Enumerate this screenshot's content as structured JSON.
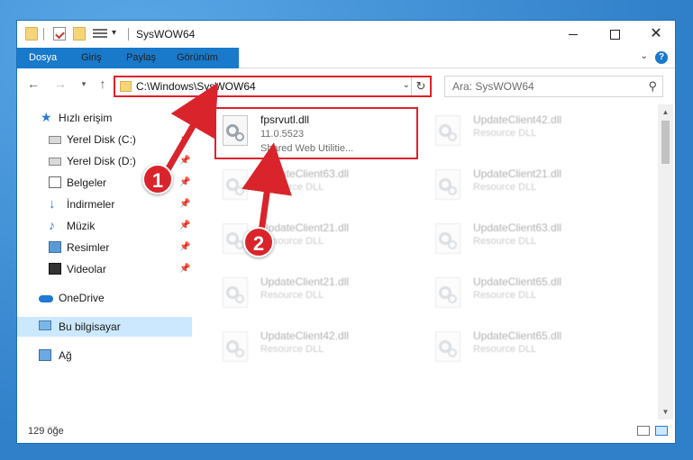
{
  "window": {
    "title": "SysWOW64"
  },
  "ribbon": {
    "tabs": [
      "Dosya",
      "Giriş",
      "Paylaş",
      "Görünüm"
    ],
    "help": "?"
  },
  "address": {
    "path": "C:\\Windows\\SysWOW64",
    "search_placeholder": "Ara: SysWOW64"
  },
  "sidebar": {
    "items": [
      {
        "label": "Hızlı erişim",
        "icon": "star-icon",
        "pinned": false
      },
      {
        "label": "Yerel Disk (C:)",
        "icon": "disk-icon",
        "pinned": true
      },
      {
        "label": "Yerel Disk (D:)",
        "icon": "disk-icon",
        "pinned": true
      },
      {
        "label": "Belgeler",
        "icon": "document-icon",
        "pinned": true
      },
      {
        "label": "İndirmeler",
        "icon": "download-icon",
        "pinned": true
      },
      {
        "label": "Müzik",
        "icon": "music-icon",
        "pinned": true
      },
      {
        "label": "Resimler",
        "icon": "pictures-icon",
        "pinned": true
      },
      {
        "label": "Videolar",
        "icon": "video-icon",
        "pinned": true
      },
      {
        "label": "OneDrive",
        "icon": "cloud-icon",
        "pinned": false
      },
      {
        "label": "Bu bilgisayar",
        "icon": "computer-icon",
        "pinned": false
      },
      {
        "label": "Ağ",
        "icon": "network-icon",
        "pinned": false
      }
    ]
  },
  "files": {
    "highlighted": {
      "name": "fpsrvutl.dll",
      "version": "11.0.5523",
      "description": "Shared Web Utilitie..."
    },
    "faded": [
      {
        "name": "UpdateClient42.dll",
        "description": "Resource DLL"
      },
      {
        "name": "UpdateClient63.dll",
        "description": "Resource DLL"
      },
      {
        "name": "UpdateClient21.dll",
        "description": "Resource DLL"
      },
      {
        "name": "UpdateClient21.dll",
        "description": "Resource DLL"
      },
      {
        "name": "UpdateClient63.dll",
        "description": "Resource DLL"
      },
      {
        "name": "UpdateClient21.dll",
        "description": "Resource DLL"
      },
      {
        "name": "UpdateClient65.dll",
        "description": "Resource DLL"
      },
      {
        "name": "UpdateClient42.dll",
        "description": "Resource DLL"
      },
      {
        "name": "UpdateClient65.dll",
        "description": "Resource DLL"
      }
    ]
  },
  "status": {
    "item_count": "129 öğe"
  },
  "callouts": [
    "1",
    "2"
  ],
  "colors": {
    "accent": "#1979ca",
    "highlight": "#e0202a",
    "selection": "#cce8ff"
  }
}
